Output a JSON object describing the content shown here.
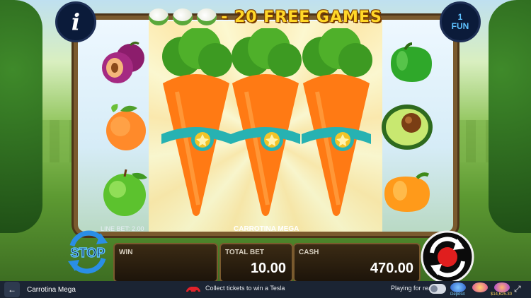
{
  "game": {
    "banner_text": "- 20 FREE GAMES",
    "info_label": "i",
    "fun_count": "1",
    "fun_label": "FUN",
    "title": "CARROTINA MEGA",
    "line_bet": "LINE BET: 2.00"
  },
  "panels": {
    "win_label": "WIN",
    "win_value": "",
    "total_bet_label": "TOTAL BET",
    "total_bet_value": "10.00",
    "cash_label": "CASH",
    "cash_value": "470.00"
  },
  "controls": {
    "stop_label": "STOP"
  },
  "bottombar": {
    "back_icon": "←",
    "title": "Carrotina Mega",
    "promo": "Collect tickets to win a Tesla",
    "playing_for_real": "Playing for real",
    "badge1": "Deposit",
    "badge3": "$14,625.30",
    "fullscreen_icon": "⤢"
  },
  "colors": {
    "banner": "#ffd728",
    "accent_blue": "#5fc2ff",
    "panel_border": "#7a5a2e"
  }
}
